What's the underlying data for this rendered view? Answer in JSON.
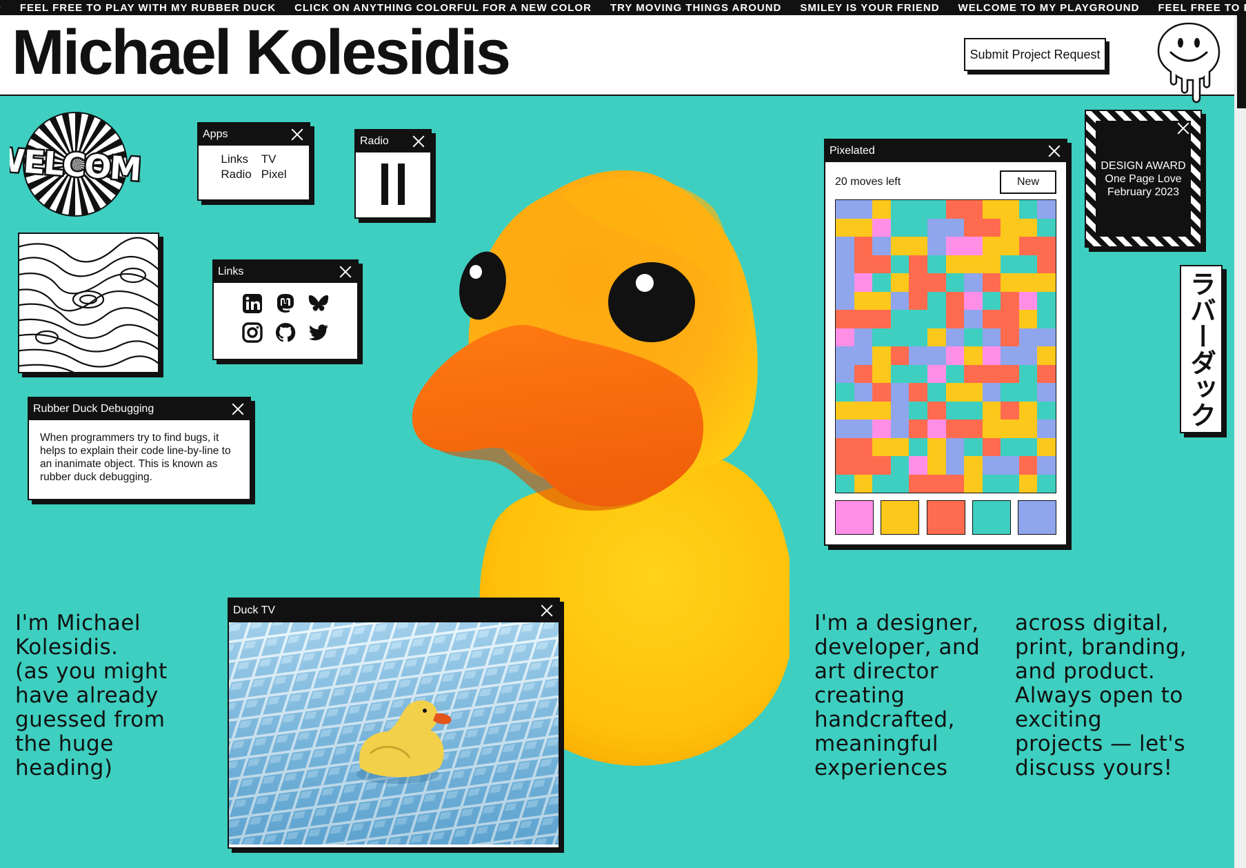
{
  "marquee": {
    "items": [
      "D",
      "FEEL FREE TO PLAY WITH MY RUBBER DUCK",
      "CLICK ON ANYTHING COLORFUL FOR A NEW COLOR",
      "TRY MOVING THINGS AROUND",
      "SMILEY IS YOUR FRIEND",
      "WELCOME TO MY PLAYGROUND",
      "FEEL FREE TO PLAY WI"
    ]
  },
  "header": {
    "title": "Michael Kolesidis",
    "cta_label": "Submit Project Request"
  },
  "welcome_sticker": {
    "text": "WELCOME"
  },
  "apps_window": {
    "title": "Apps",
    "items": [
      "Links",
      "TV",
      "Radio",
      "Pixel"
    ]
  },
  "radio_window": {
    "title": "Radio",
    "state": "playing"
  },
  "links_window": {
    "title": "Links",
    "icons": [
      "linkedin-icon",
      "mastodon-icon",
      "bluesky-icon",
      "instagram-icon",
      "github-icon",
      "twitter-icon"
    ]
  },
  "debug_window": {
    "title": "Rubber Duck Debugging",
    "body": "When programmers try to find bugs, it helps to explain their code line-by-line to an inanimate object. This is known as rubber duck debugging."
  },
  "pixel_window": {
    "title": "Pixelated",
    "moves": "20 moves left",
    "new_label": "New",
    "colors": [
      "#ff8fe6",
      "#fcc81b",
      "#ff6b4f",
      "#3ecfc0",
      "#8fa5ec"
    ],
    "grid": [
      "441333221134",
      "110334422113",
      "424114001122",
      "422323111332",
      "403122342111",
      "411423203203",
      "222333242213",
      "043331434244",
      "441244010441",
      "421330322232",
      "342423114334",
      "111432331213",
      "440420221114",
      "221131432331",
      "222301414424",
      "313322213313"
    ]
  },
  "award": {
    "line1": "DESIGN AWARD",
    "line2": "One Page Love",
    "line3": "February 2023"
  },
  "japanese_label": "ラバーダック",
  "tv_window": {
    "title": "Duck TV"
  },
  "bio": {
    "left": "I'm Michael\nKolesidis.\n(as you might\nhave already\nguessed from\nthe huge\nheading)",
    "right1": "I'm a designer,\ndeveloper, and\nart director\ncreating\nhandcrafted,\nmeaningful\nexperiences",
    "right2": "across digital,\nprint, branding,\nand product.\nAlways open to\nexciting\nprojects — let's\ndiscuss yours!"
  },
  "colors": {
    "background": "#3ecfc0",
    "duck_yellow": "#ffc90e",
    "duck_beak": "#f76f0e",
    "ink": "#111111"
  }
}
